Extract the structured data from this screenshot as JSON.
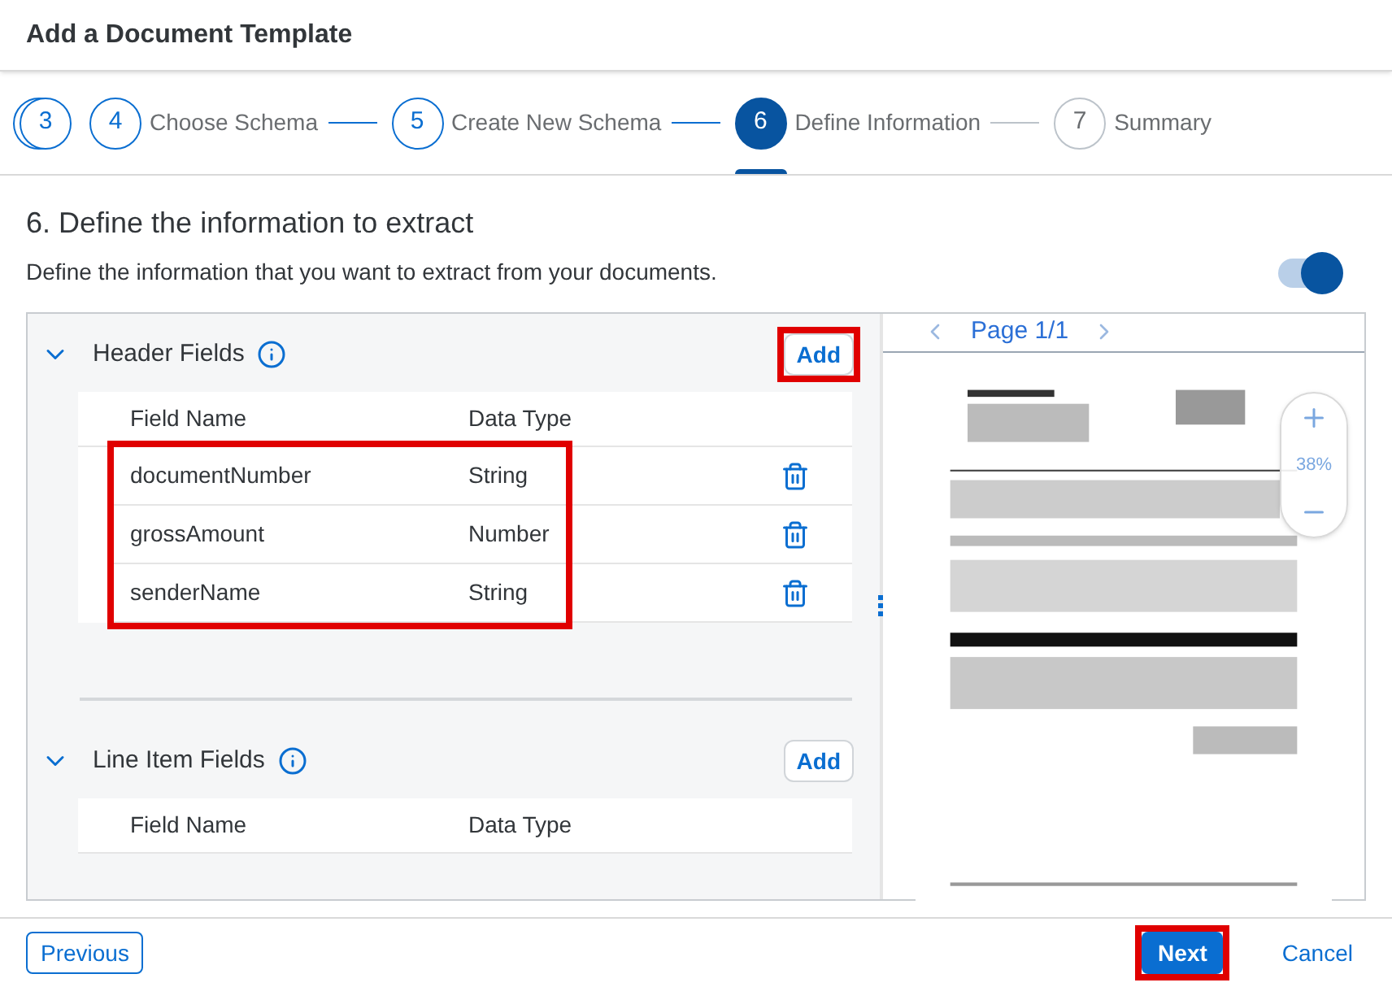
{
  "dialog": {
    "title": "Add a Document Template"
  },
  "steps": [
    {
      "number": "3",
      "kind": "overflow",
      "completed": true,
      "selected": false
    },
    {
      "number": "4",
      "label": "Choose Schema",
      "kind": "step",
      "completed": true,
      "selected": false
    },
    {
      "number": "5",
      "label": "Create New Schema",
      "kind": "step",
      "completed": true,
      "selected": false
    },
    {
      "number": "6",
      "label": "Define Information",
      "kind": "step",
      "completed": false,
      "selected": true
    },
    {
      "number": "7",
      "label": "Summary",
      "kind": "step",
      "completed": false,
      "selected": false
    }
  ],
  "section": {
    "title": "6. Define the information to extract",
    "description": "Define the information that you want to extract from your documents.",
    "toggle": {
      "on": true
    }
  },
  "field_groups": [
    {
      "title": "Header Fields",
      "expanded": true,
      "add_button": {
        "label": "Add",
        "highlighted": true
      },
      "columns": [
        "Field Name",
        "Data Type"
      ],
      "rows_highlighted": true,
      "rows": [
        {
          "field_name": "documentNumber",
          "data_type": "String"
        },
        {
          "field_name": "grossAmount",
          "data_type": "Number"
        },
        {
          "field_name": "senderName",
          "data_type": "String"
        }
      ]
    },
    {
      "title": "Line Item Fields",
      "expanded": true,
      "add_button": {
        "label": "Add",
        "highlighted": false
      },
      "columns": [
        "Field Name",
        "Data Type"
      ]
    }
  ],
  "preview": {
    "page_label": "Page 1/1",
    "zoom": "38%"
  },
  "footer": {
    "previous": "Previous",
    "next": {
      "label": "Next",
      "highlighted": true
    },
    "cancel": "Cancel"
  }
}
